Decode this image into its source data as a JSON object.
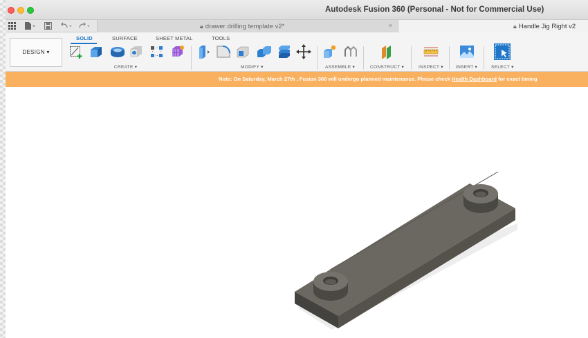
{
  "window": {
    "title": "Autodesk Fusion 360 (Personal - Not for Commercial Use)"
  },
  "tabs": [
    {
      "label": "drawer drilling template v2*",
      "close": "×"
    },
    {
      "label": "Handle Jig Right v2"
    }
  ],
  "workspace": {
    "mode_label": "DESIGN ▾",
    "tabs": [
      "SOLID",
      "SURFACE",
      "SHEET METAL",
      "TOOLS"
    ],
    "active_tab": "SOLID"
  },
  "toolbar_groups": {
    "create": "CREATE ▾",
    "modify": "MODIFY ▾",
    "assemble": "ASSEMBLE ▾",
    "construct": "CONSTRUCT ▾",
    "inspect": "INSPECT ▾",
    "insert": "INSERT ▾",
    "select": "SELECT ▾"
  },
  "notice": {
    "text_before": "Note: On Saturday, March 27th , Fusion 360 will undergo planned maintenance. Please check ",
    "link": "Health Dashboard",
    "text_after": " for exact timing"
  },
  "colors": {
    "accent": "#1f76c8",
    "notice_bg": "#f9b05f",
    "model_body": "#55524c"
  },
  "icons": [
    "grid-icon",
    "file-icon",
    "save-icon",
    "undo-icon",
    "redo-icon",
    "lock-icon"
  ]
}
